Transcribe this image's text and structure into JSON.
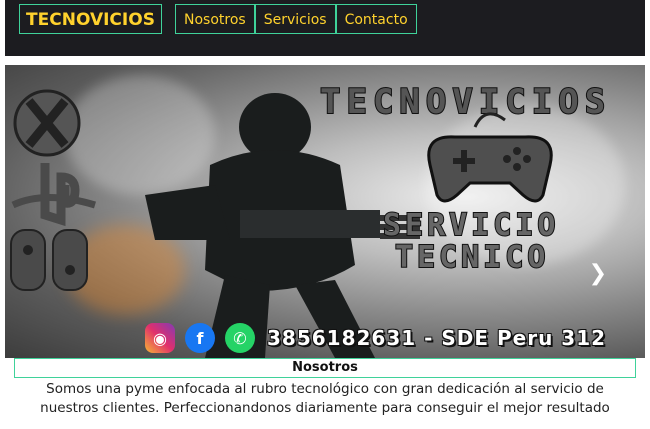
{
  "navbar": {
    "brand": "TECNOVICIOS",
    "links": [
      "Nosotros",
      "Servicios",
      "Contacto"
    ]
  },
  "hero": {
    "title": "TECNOVICIOS",
    "service_line1": "SERVICIO",
    "service_line2": "TECNICO",
    "contact": "3856182631 - SDE Peru 312"
  },
  "section": {
    "title": "Nosotros",
    "body": "Somos una pyme enfocada al rubro tecnológico con gran dedicación al servicio de nuestros clientes. Perfeccionandonos diariamente para conseguir el mejor resultado"
  },
  "colors": {
    "accent_border": "#3fd29a",
    "nav_text": "#ffd22d",
    "nav_bg": "#1c1c20"
  },
  "icons": [
    "xbox-icon",
    "playstation-icon",
    "switch-joycon-icon",
    "gamepad-icon",
    "instagram-icon",
    "facebook-icon",
    "whatsapp-icon",
    "chevron-right-icon"
  ]
}
